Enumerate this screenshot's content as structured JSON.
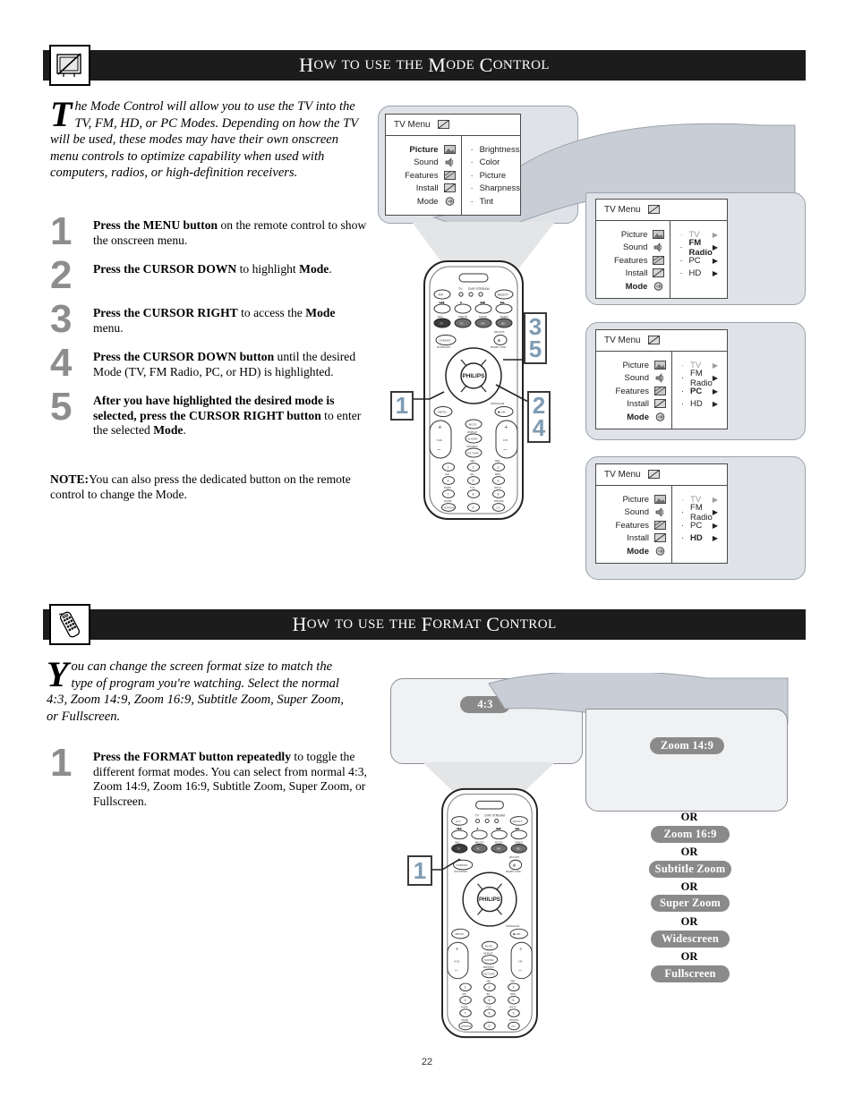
{
  "page": {
    "number": "22"
  },
  "sections": [
    {
      "id": "mode",
      "icon_name": "tv-crossed-icon",
      "title_parts": [
        {
          "cap": "H",
          "rest": "OW"
        },
        {
          "cap": "",
          "rest": "TO"
        },
        {
          "cap": "",
          "rest": "USE"
        },
        {
          "cap": "",
          "rest": "THE"
        },
        {
          "cap": "M",
          "rest": "ODE"
        },
        {
          "cap": "C",
          "rest": "ONTROL"
        }
      ],
      "title_text": "How to use the Mode Control",
      "intro_dropcap": "T",
      "intro": "he Mode Control will allow you to use the TV into the TV, FM, HD, or PC Modes. Depending on how the TV will be used, these modes may have their own onscreen menu controls to optimize capability when used with computers, radios, or high-definition receivers.",
      "steps": [
        {
          "num": "1",
          "html": "<b>Press the MENU button</b> on the remote control to show the onscreen menu."
        },
        {
          "num": "2",
          "html": "<b>Press the CURSOR DOWN</b> to highlight <b>Mode</b>."
        },
        {
          "num": "3",
          "html": "<b>Press the CURSOR RIGHT</b> to access the <b>Mode</b> menu."
        },
        {
          "num": "4",
          "html": "<b>Press the CURSOR DOWN button</b> until the desired Mode (TV, FM Radio, PC, or HD) is highlighted."
        },
        {
          "num": "5",
          "html": "<b>After you have highlighted the desired mode is selected, press the CURSOR RIGHT button</b> to enter the selected <b>Mode</b>."
        }
      ],
      "note_label": "NOTE:",
      "note_text": "You can also press the dedicated button on the remote control to change the Mode."
    },
    {
      "id": "format",
      "icon_name": "remote-control-icon",
      "title_text": "How to use the Format Control",
      "intro_dropcap": "Y",
      "intro": "ou can change the screen format size to match the type of program you're watching. Select the normal 4:3, Zoom 14:9, Zoom 16:9, Subtitle Zoom, Super Zoom, or Fullscreen.",
      "steps": [
        {
          "num": "1",
          "html": "<b>Press the FORMAT button repeatedly</b> to toggle the different format modes. You can select from normal 4:3, Zoom 14:9, Zoom 16:9, Subtitle Zoom, Super Zoom, or Fullscreen."
        }
      ]
    }
  ],
  "tv_menus": [
    {
      "id": "menu-picture",
      "header": "TV Menu",
      "header_icon": "tv-icon",
      "left_items": [
        {
          "label": "Picture",
          "bold": true,
          "icon": "picture-icon"
        },
        {
          "label": "Sound",
          "bold": false,
          "icon": "sound-icon"
        },
        {
          "label": "Features",
          "bold": false,
          "icon": "features-icon"
        },
        {
          "label": "Install",
          "bold": false,
          "icon": "install-icon"
        },
        {
          "label": "Mode",
          "bold": false,
          "icon": "mode-icon"
        }
      ],
      "right_items": [
        {
          "label": "Brightness",
          "bold": false,
          "dim": false,
          "arrow": false
        },
        {
          "label": "Color",
          "bold": false,
          "dim": false,
          "arrow": false
        },
        {
          "label": "Picture",
          "bold": false,
          "dim": false,
          "arrow": false
        },
        {
          "label": "Sharpness",
          "bold": false,
          "dim": false,
          "arrow": false
        },
        {
          "label": "Tint",
          "bold": false,
          "dim": false,
          "arrow": false
        }
      ]
    },
    {
      "id": "menu-fmradio",
      "header": "TV Menu",
      "header_icon": "tv-icon",
      "left_items": [
        {
          "label": "Picture",
          "bold": false,
          "icon": "picture-icon"
        },
        {
          "label": "Sound",
          "bold": false,
          "icon": "sound-icon"
        },
        {
          "label": "Features",
          "bold": false,
          "icon": "features-icon"
        },
        {
          "label": "Install",
          "bold": false,
          "icon": "install-icon"
        },
        {
          "label": "Mode",
          "bold": true,
          "icon": "mode-icon"
        }
      ],
      "right_items": [
        {
          "label": "TV",
          "bold": false,
          "dim": true,
          "arrow": true
        },
        {
          "label": "FM Radio",
          "bold": true,
          "dim": false,
          "arrow": true
        },
        {
          "label": "PC",
          "bold": false,
          "dim": false,
          "arrow": true
        },
        {
          "label": "HD",
          "bold": false,
          "dim": false,
          "arrow": true
        }
      ]
    },
    {
      "id": "menu-pc",
      "header": "TV Menu",
      "header_icon": "tv-icon",
      "left_items": [
        {
          "label": "Picture",
          "bold": false,
          "icon": "picture-icon"
        },
        {
          "label": "Sound",
          "bold": false,
          "icon": "sound-icon"
        },
        {
          "label": "Features",
          "bold": false,
          "icon": "features-icon"
        },
        {
          "label": "Install",
          "bold": false,
          "icon": "install-icon"
        },
        {
          "label": "Mode",
          "bold": true,
          "icon": "mode-icon"
        }
      ],
      "right_items": [
        {
          "label": "TV",
          "bold": false,
          "dim": true,
          "arrow": true
        },
        {
          "label": "FM Radio",
          "bold": false,
          "dim": false,
          "arrow": true
        },
        {
          "label": "PC",
          "bold": true,
          "dim": false,
          "arrow": true
        },
        {
          "label": "HD",
          "bold": false,
          "dim": false,
          "arrow": true
        }
      ]
    },
    {
      "id": "menu-hd",
      "header": "TV Menu",
      "header_icon": "tv-icon",
      "left_items": [
        {
          "label": "Picture",
          "bold": false,
          "icon": "picture-icon"
        },
        {
          "label": "Sound",
          "bold": false,
          "icon": "sound-icon"
        },
        {
          "label": "Features",
          "bold": false,
          "icon": "features-icon"
        },
        {
          "label": "Install",
          "bold": false,
          "icon": "install-icon"
        },
        {
          "label": "Mode",
          "bold": true,
          "icon": "mode-icon"
        }
      ],
      "right_items": [
        {
          "label": "TV",
          "bold": false,
          "dim": true,
          "arrow": true
        },
        {
          "label": "FM Radio",
          "bold": false,
          "dim": false,
          "arrow": true
        },
        {
          "label": "PC",
          "bold": false,
          "dim": false,
          "arrow": true
        },
        {
          "label": "HD",
          "bold": true,
          "dim": false,
          "arrow": true
        }
      ]
    }
  ],
  "callout_tags": {
    "mode_tag_1": "1",
    "mode_tag_35_a": "3",
    "mode_tag_35_b": "5",
    "mode_tag_24_a": "2",
    "mode_tag_24_b": "4",
    "format_tag_1": "1"
  },
  "format_screens": [
    {
      "label": "4:3"
    },
    {
      "label": "Zoom 14:9"
    }
  ],
  "format_list": [
    {
      "or": "OR",
      "label": "Zoom 16:9"
    },
    {
      "or": "OR",
      "label": "Subtitle Zoom"
    },
    {
      "or": "OR",
      "label": "Super Zoom"
    },
    {
      "or": "OR",
      "label": "Widescreen"
    },
    {
      "or": "OR",
      "label": "Fullscreen"
    }
  ],
  "remote": {
    "brand": "PHILIPS",
    "buttons": {
      "power": "⏻",
      "av": "A/V",
      "select": "SELECT",
      "format": "FORMAT",
      "internet": "INTERNET",
      "menu": "MENU",
      "ok": "OK",
      "program": "PROGRAM",
      "vol": "VOL",
      "ch": "CH",
      "mute": "MUTE",
      "sound": "SOUND",
      "picture": "PICTURE",
      "delete": "DELETE",
      "homelink": "HOME LINK",
      "tv": "TV",
      "dvr_stream": "DVR STREAM"
    }
  },
  "colors": {
    "header_bar": "#1c1c1c",
    "balloon": "#dfe3e8",
    "balloon_border": "#9aa2ab",
    "screen": "#f0f1f3",
    "step_number": "#8d8d8d",
    "tag_number": "#7f9bb3",
    "pill": "#8a8a8a"
  }
}
